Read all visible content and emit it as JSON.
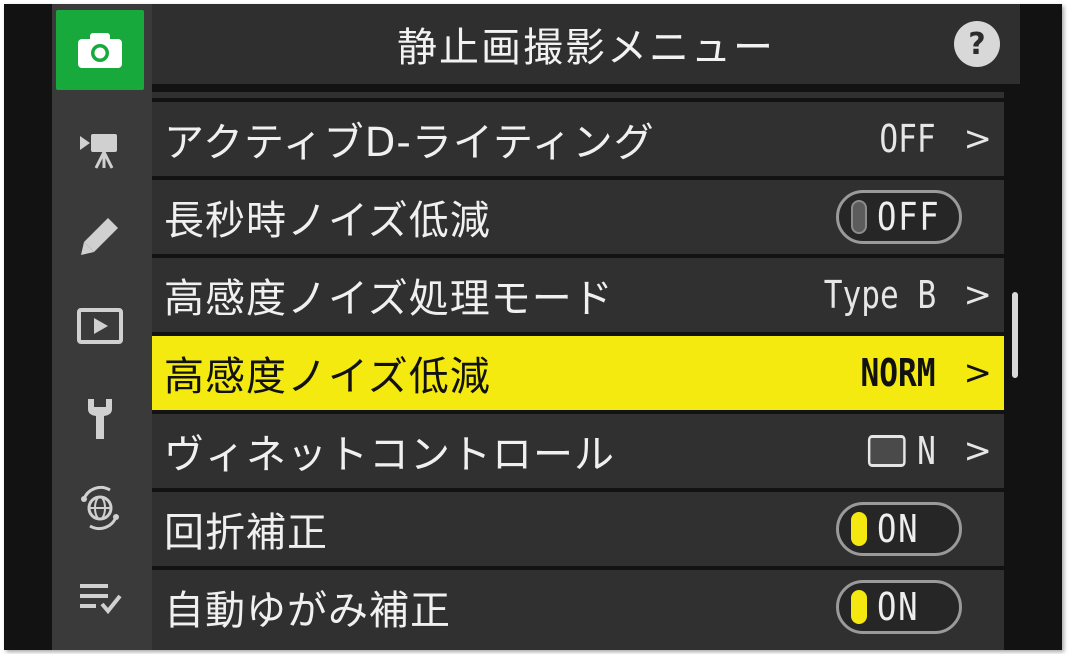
{
  "header": {
    "title": "静止画撮影メニュー",
    "help_label": "?"
  },
  "sidebar": {
    "tabs": [
      {
        "icon": "camera-icon",
        "active": true
      },
      {
        "icon": "movie-camera-icon",
        "active": false
      },
      {
        "icon": "pencil-icon",
        "active": false
      },
      {
        "icon": "playback-icon",
        "active": false
      },
      {
        "icon": "wrench-icon",
        "active": false
      },
      {
        "icon": "network-icon",
        "active": false
      },
      {
        "icon": "my-menu-icon",
        "active": false
      }
    ]
  },
  "menu": {
    "items": [
      {
        "label": "アクティブD-ライティング",
        "value": "OFF"
      },
      {
        "label": "長秒時ノイズ低減",
        "toggle": "OFF"
      },
      {
        "label": "高感度ノイズ処理モード",
        "value": "Type B"
      },
      {
        "label": "高感度ノイズ低減",
        "value": "NORM",
        "selected": true
      },
      {
        "label": "ヴィネットコントロール",
        "value": "N"
      },
      {
        "label": "回折補正",
        "toggle": "ON"
      },
      {
        "label": "自動ゆがみ補正",
        "toggle": "ON"
      }
    ],
    "chevron": ">"
  },
  "colors": {
    "accent_green": "#17a93c",
    "highlight_yellow": "#f4ea10",
    "row_bg": "#303030",
    "sidebar_bg": "#3a3a3a"
  }
}
